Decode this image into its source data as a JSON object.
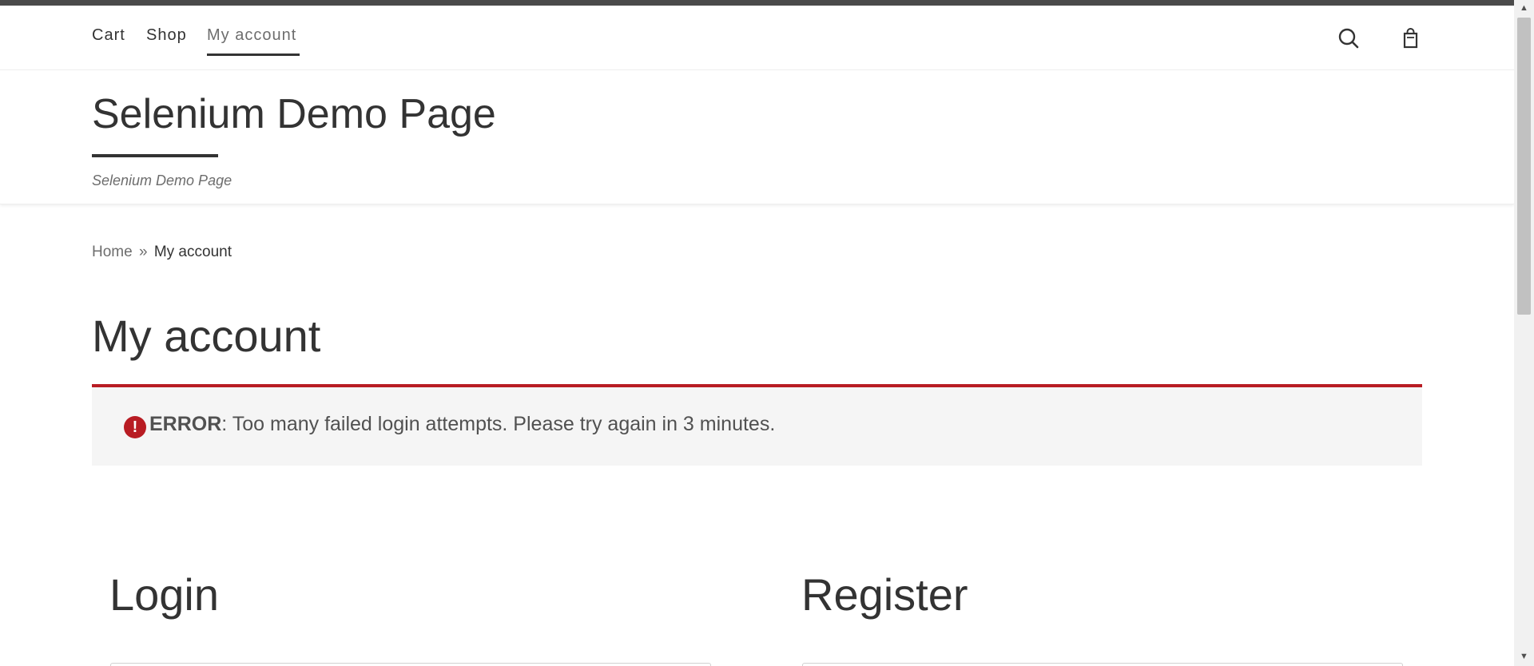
{
  "nav": {
    "items": [
      {
        "label": "Cart"
      },
      {
        "label": "Shop"
      },
      {
        "label": "My account"
      }
    ],
    "search_icon": "search-icon",
    "cart_icon": "shopping-bag-icon"
  },
  "site": {
    "title": "Selenium Demo Page",
    "tagline": "Selenium Demo Page"
  },
  "breadcrumb": {
    "home": "Home",
    "separator": "»",
    "current": "My account"
  },
  "page": {
    "title": "My account"
  },
  "notice": {
    "icon": "!",
    "label": "ERROR",
    "message": ": Too many failed login attempts. Please try again in 3 minutes."
  },
  "columns": {
    "login_title": "Login",
    "register_title": "Register"
  },
  "scrollbar": {
    "up": "▲",
    "down": "▼"
  },
  "colors": {
    "error_accent": "#b81c23",
    "text": "#333333",
    "muted": "#6d6d6d"
  }
}
